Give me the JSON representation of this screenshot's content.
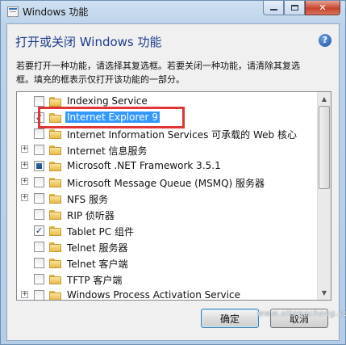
{
  "window": {
    "title": "Windows 功能"
  },
  "caption": {
    "minimize": "—",
    "maximize": "□",
    "close": "✕"
  },
  "dialog": {
    "heading": "打开或关闭 Windows 功能",
    "help": "?",
    "description_line1": "若要打开一种功能，请选择其复选框。若要关闭一种功能，请清除其复选",
    "description_line2": "框。填充的框表示仅打开该功能的一部分。"
  },
  "features": [
    {
      "label": "Indexing Service",
      "state": "unchecked",
      "expandable": false
    },
    {
      "label": "Internet Explorer 9",
      "state": "checked",
      "expandable": false,
      "selected": true
    },
    {
      "label": "Internet Information Services 可承载的 Web 核心",
      "state": "unchecked",
      "expandable": false
    },
    {
      "label": "Internet 信息服务",
      "state": "unchecked",
      "expandable": true
    },
    {
      "label": "Microsoft .NET Framework 3.5.1",
      "state": "partial",
      "expandable": true
    },
    {
      "label": "Microsoft Message Queue (MSMQ) 服务器",
      "state": "unchecked",
      "expandable": true
    },
    {
      "label": "NFS 服务",
      "state": "unchecked",
      "expandable": true
    },
    {
      "label": "RIP 侦听器",
      "state": "unchecked",
      "expandable": false
    },
    {
      "label": "Tablet PC 组件",
      "state": "checked",
      "expandable": false
    },
    {
      "label": "Telnet 服务器",
      "state": "unchecked",
      "expandable": false
    },
    {
      "label": "Telnet 客户端",
      "state": "unchecked",
      "expandable": false
    },
    {
      "label": "TFTP 客户端",
      "state": "unchecked",
      "expandable": false
    },
    {
      "label": "Windows Process Activation Service",
      "state": "unchecked",
      "expandable": true
    }
  ],
  "buttons": {
    "ok": "确定",
    "cancel": "取消"
  },
  "watermark": "www.xitongcheng.com",
  "colors": {
    "heading": "#1f3c8f",
    "selection": "#3399ff",
    "highlight_box": "#e03535"
  }
}
